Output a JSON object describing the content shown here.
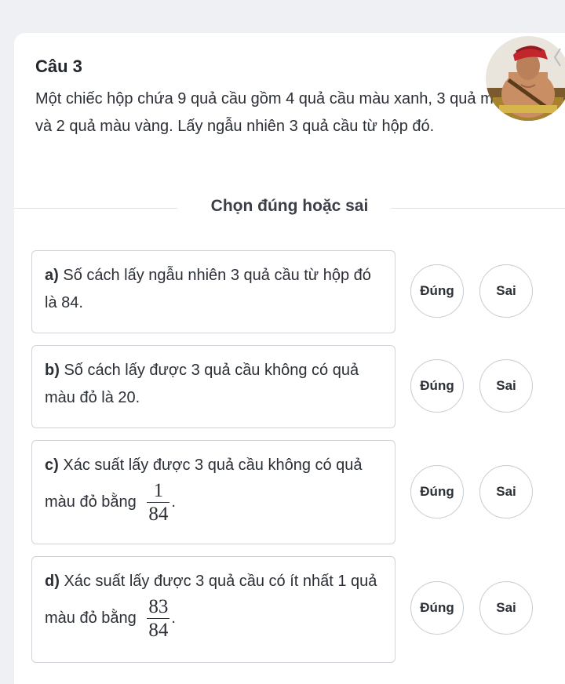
{
  "question": {
    "title": "Câu 3",
    "text": "Một chiếc hộp chứa 9 quả cầu gồm 4 quả cầu màu xanh, 3 quả màu đỏ và 2 quả màu vàng. Lấy ngẫu nhiên 3 quả cầu từ hộp đó."
  },
  "section": {
    "label": "Chọn đúng hoặc sai"
  },
  "statements": [
    {
      "label": "a)",
      "text": "Số cách lấy ngẫu nhiên 3 quả cầu từ hộp đó là 84.",
      "true_label": "Đúng",
      "false_label": "Sai"
    },
    {
      "label": "b)",
      "text": "Số cách lấy được 3 quả cầu không có quả màu đỏ là 20.",
      "true_label": "Đúng",
      "false_label": "Sai"
    },
    {
      "label": "c)",
      "text": "Xác suất lấy được 3 quả cầu không có quả màu đỏ bằng",
      "frac_num": "1",
      "frac_den": "84",
      "suffix": ".",
      "true_label": "Đúng",
      "false_label": "Sai"
    },
    {
      "label": "d)",
      "text": "Xác suất lấy được 3 quả cầu có ít nhất 1 quả màu đỏ bằng",
      "frac_num": "83",
      "frac_den": "84",
      "suffix": ".",
      "true_label": "Đúng",
      "false_label": "Sai"
    }
  ],
  "colors": {
    "page_bg": "#eef0f3",
    "card_bg": "#ffffff",
    "border": "#cfd4da",
    "text": "#2b2f36"
  }
}
